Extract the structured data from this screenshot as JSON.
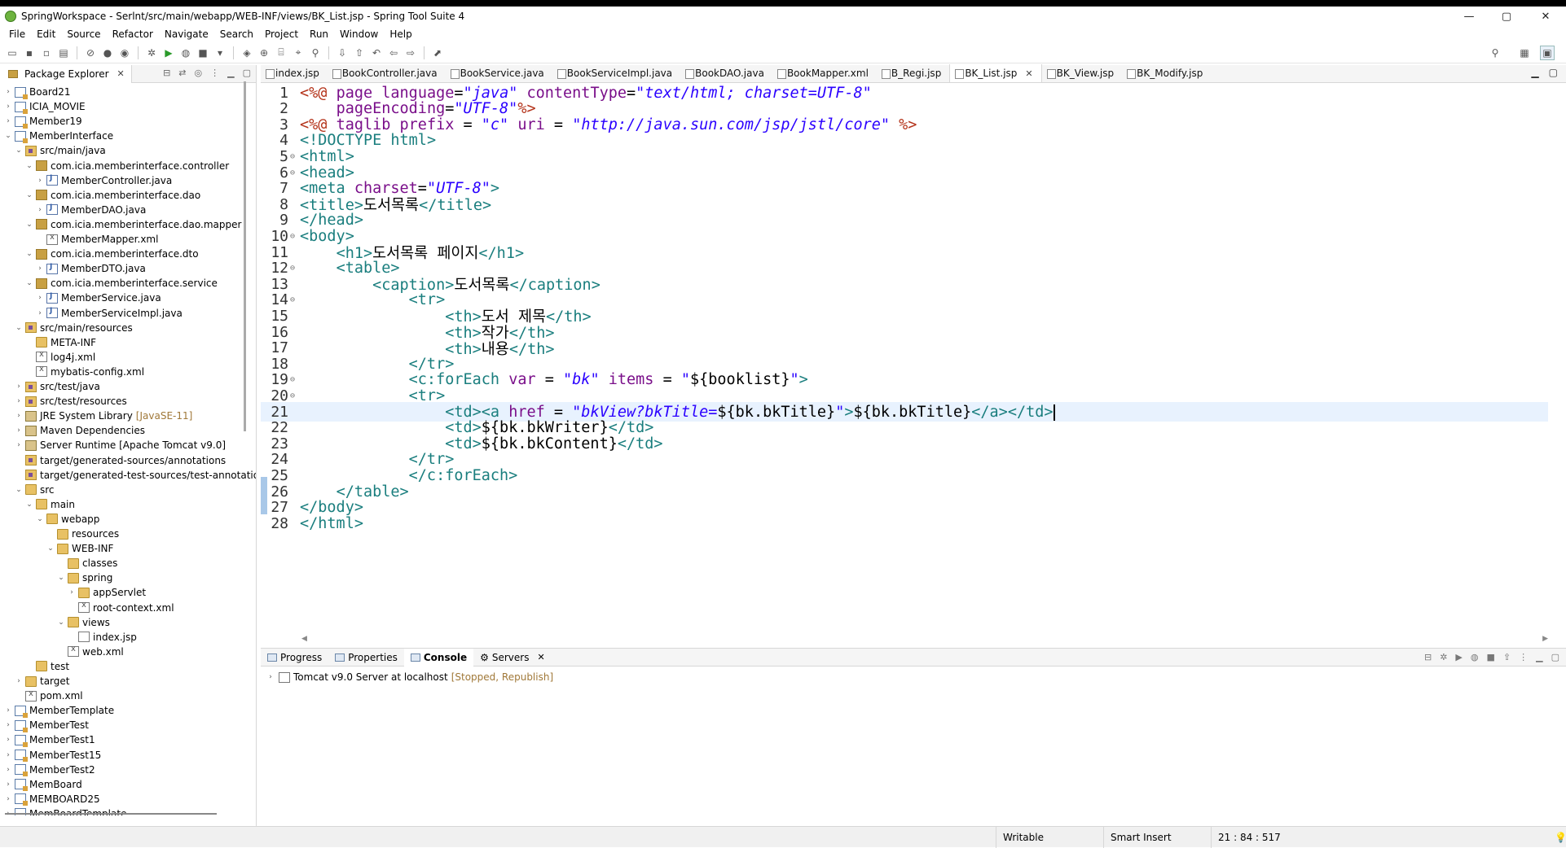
{
  "window": {
    "title": "SpringWorkspace - Serlnt/src/main/webapp/WEB-INF/views/BK_List.jsp - Spring Tool Suite 4",
    "minimize": "—",
    "maximize": "▢",
    "close": "✕"
  },
  "menu": [
    "File",
    "Edit",
    "Source",
    "Refactor",
    "Navigate",
    "Search",
    "Project",
    "Run",
    "Window",
    "Help"
  ],
  "left_panel": {
    "tab_label": "Package Explorer",
    "tree": [
      {
        "depth": 0,
        "twisty": "›",
        "icon": "project",
        "label": "Board21"
      },
      {
        "depth": 0,
        "twisty": "›",
        "icon": "project",
        "label": "ICIA_MOVIE"
      },
      {
        "depth": 0,
        "twisty": "›",
        "icon": "project",
        "label": "Member19"
      },
      {
        "depth": 0,
        "twisty": "⌄",
        "icon": "project",
        "label": "MemberInterface"
      },
      {
        "depth": 1,
        "twisty": "⌄",
        "icon": "src",
        "label": "src/main/java"
      },
      {
        "depth": 2,
        "twisty": "⌄",
        "icon": "pkg",
        "label": "com.icia.memberinterface.controller"
      },
      {
        "depth": 3,
        "twisty": "›",
        "icon": "java",
        "label": "MemberController.java"
      },
      {
        "depth": 2,
        "twisty": "⌄",
        "icon": "pkg",
        "label": "com.icia.memberinterface.dao"
      },
      {
        "depth": 3,
        "twisty": "›",
        "icon": "java",
        "label": "MemberDAO.java"
      },
      {
        "depth": 2,
        "twisty": "⌄",
        "icon": "pkg",
        "label": "com.icia.memberinterface.dao.mapper"
      },
      {
        "depth": 3,
        "twisty": "",
        "icon": "xml",
        "label": "MemberMapper.xml"
      },
      {
        "depth": 2,
        "twisty": "⌄",
        "icon": "pkg",
        "label": "com.icia.memberinterface.dto"
      },
      {
        "depth": 3,
        "twisty": "›",
        "icon": "java",
        "label": "MemberDTO.java"
      },
      {
        "depth": 2,
        "twisty": "⌄",
        "icon": "pkg",
        "label": "com.icia.memberinterface.service"
      },
      {
        "depth": 3,
        "twisty": "›",
        "icon": "java",
        "label": "MemberService.java"
      },
      {
        "depth": 3,
        "twisty": "›",
        "icon": "java",
        "label": "MemberServiceImpl.java"
      },
      {
        "depth": 1,
        "twisty": "⌄",
        "icon": "src",
        "label": "src/main/resources"
      },
      {
        "depth": 2,
        "twisty": "",
        "icon": "folder",
        "label": "META-INF"
      },
      {
        "depth": 2,
        "twisty": "",
        "icon": "xml",
        "label": "log4j.xml"
      },
      {
        "depth": 2,
        "twisty": "",
        "icon": "xml",
        "label": "mybatis-config.xml"
      },
      {
        "depth": 1,
        "twisty": "›",
        "icon": "src",
        "label": "src/test/java"
      },
      {
        "depth": 1,
        "twisty": "›",
        "icon": "src",
        "label": "src/test/resources"
      },
      {
        "depth": 1,
        "twisty": "›",
        "icon": "lib",
        "label": "JRE System Library",
        "extra": "[JavaSE-11]"
      },
      {
        "depth": 1,
        "twisty": "›",
        "icon": "lib",
        "label": "Maven Dependencies"
      },
      {
        "depth": 1,
        "twisty": "›",
        "icon": "lib",
        "label": "Server Runtime [Apache Tomcat v9.0]"
      },
      {
        "depth": 1,
        "twisty": "",
        "icon": "src",
        "label": "target/generated-sources/annotations"
      },
      {
        "depth": 1,
        "twisty": "",
        "icon": "src",
        "label": "target/generated-test-sources/test-annotatio"
      },
      {
        "depth": 1,
        "twisty": "⌄",
        "icon": "folder",
        "label": "src"
      },
      {
        "depth": 2,
        "twisty": "⌄",
        "icon": "folder",
        "label": "main"
      },
      {
        "depth": 3,
        "twisty": "⌄",
        "icon": "folder",
        "label": "webapp"
      },
      {
        "depth": 4,
        "twisty": "",
        "icon": "folder",
        "label": "resources"
      },
      {
        "depth": 4,
        "twisty": "⌄",
        "icon": "folder",
        "label": "WEB-INF"
      },
      {
        "depth": 5,
        "twisty": "",
        "icon": "folder",
        "label": "classes"
      },
      {
        "depth": 5,
        "twisty": "⌄",
        "icon": "folder",
        "label": "spring"
      },
      {
        "depth": 6,
        "twisty": "›",
        "icon": "folder",
        "label": "appServlet"
      },
      {
        "depth": 6,
        "twisty": "",
        "icon": "xml",
        "label": "root-context.xml"
      },
      {
        "depth": 5,
        "twisty": "⌄",
        "icon": "folder",
        "label": "views"
      },
      {
        "depth": 6,
        "twisty": "",
        "icon": "jsp",
        "label": "index.jsp"
      },
      {
        "depth": 5,
        "twisty": "",
        "icon": "xml",
        "label": "web.xml"
      },
      {
        "depth": 2,
        "twisty": "",
        "icon": "folder",
        "label": "test"
      },
      {
        "depth": 1,
        "twisty": "›",
        "icon": "folder",
        "label": "target"
      },
      {
        "depth": 1,
        "twisty": "",
        "icon": "xml",
        "label": "pom.xml"
      },
      {
        "depth": 0,
        "twisty": "›",
        "icon": "project",
        "label": "MemberTemplate"
      },
      {
        "depth": 0,
        "twisty": "›",
        "icon": "project",
        "label": "MemberTest"
      },
      {
        "depth": 0,
        "twisty": "›",
        "icon": "project",
        "label": "MemberTest1"
      },
      {
        "depth": 0,
        "twisty": "›",
        "icon": "project",
        "label": "MemberTest15"
      },
      {
        "depth": 0,
        "twisty": "›",
        "icon": "project",
        "label": "MemberTest2"
      },
      {
        "depth": 0,
        "twisty": "›",
        "icon": "project",
        "label": "MemBoard"
      },
      {
        "depth": 0,
        "twisty": "›",
        "icon": "project",
        "label": "MEMBOARD25"
      },
      {
        "depth": 0,
        "twisty": "›",
        "icon": "project",
        "label": "MemBoardTemplate"
      }
    ]
  },
  "editor": {
    "tabs": [
      "index.jsp",
      "BookController.java",
      "BookService.java",
      "BookServiceImpl.java",
      "BookDAO.java",
      "BookMapper.xml",
      "B_Regi.jsp",
      "BK_List.jsp",
      "BK_View.jsp",
      "BK_Modify.jsp"
    ],
    "active_tab": "BK_List.jsp",
    "current_line": 21,
    "lines": [
      {
        "n": "1",
        "fold": "",
        "segs": [
          [
            "dir",
            "<%@ "
          ],
          [
            "attr",
            "page "
          ],
          [
            "attr",
            "language"
          ],
          [
            "el",
            "="
          ],
          [
            "str",
            "\"java\""
          ],
          [
            "el",
            " "
          ],
          [
            "attr",
            "contentType"
          ],
          [
            "el",
            "="
          ],
          [
            "str",
            "\"text/html; charset=UTF-8\""
          ]
        ]
      },
      {
        "n": "2",
        "fold": "",
        "segs": [
          [
            "el",
            "    "
          ],
          [
            "attr",
            "pageEncoding"
          ],
          [
            "el",
            "="
          ],
          [
            "str",
            "\"UTF-8\""
          ],
          [
            "dir",
            "%>"
          ]
        ]
      },
      {
        "n": "3",
        "fold": "",
        "segs": [
          [
            "dir",
            "<%@ "
          ],
          [
            "attr",
            "taglib "
          ],
          [
            "attr",
            "prefix"
          ],
          [
            "el",
            " = "
          ],
          [
            "str",
            "\"c\""
          ],
          [
            "el",
            " "
          ],
          [
            "attr",
            "uri"
          ],
          [
            "el",
            " = "
          ],
          [
            "str",
            "\"http://java.sun.com/jsp/jstl/core\""
          ],
          [
            "el",
            " "
          ],
          [
            "dir",
            "%>"
          ]
        ]
      },
      {
        "n": "4",
        "fold": "",
        "segs": [
          [
            "tag",
            "<!DOCTYPE "
          ],
          [
            "tag",
            "html"
          ],
          [
            "tag",
            ">"
          ]
        ]
      },
      {
        "n": "5",
        "fold": "⊖",
        "segs": [
          [
            "tag",
            "<html>"
          ]
        ]
      },
      {
        "n": "6",
        "fold": "⊖",
        "segs": [
          [
            "tag",
            "<head>"
          ]
        ]
      },
      {
        "n": "7",
        "fold": "",
        "segs": [
          [
            "tag",
            "<meta "
          ],
          [
            "attr",
            "charset"
          ],
          [
            "el",
            "="
          ],
          [
            "str",
            "\"UTF-8\""
          ],
          [
            "tag",
            ">"
          ]
        ]
      },
      {
        "n": "8",
        "fold": "",
        "segs": [
          [
            "tag",
            "<title>"
          ],
          [
            "el",
            "도서목록"
          ],
          [
            "tag",
            "</title>"
          ]
        ]
      },
      {
        "n": "9",
        "fold": "",
        "segs": [
          [
            "tag",
            "</head>"
          ]
        ]
      },
      {
        "n": "10",
        "fold": "⊖",
        "segs": [
          [
            "tag",
            "<body>"
          ]
        ]
      },
      {
        "n": "11",
        "fold": "",
        "segs": [
          [
            "el",
            "    "
          ],
          [
            "tag",
            "<h1>"
          ],
          [
            "el",
            "도서목록 페이지"
          ],
          [
            "tag",
            "</h1>"
          ]
        ]
      },
      {
        "n": "12",
        "fold": "⊖",
        "segs": [
          [
            "el",
            "    "
          ],
          [
            "tag",
            "<table>"
          ]
        ]
      },
      {
        "n": "13",
        "fold": "",
        "segs": [
          [
            "el",
            "        "
          ],
          [
            "tag",
            "<caption>"
          ],
          [
            "el",
            "도서목록"
          ],
          [
            "tag",
            "</caption>"
          ]
        ]
      },
      {
        "n": "14",
        "fold": "⊖",
        "segs": [
          [
            "el",
            "            "
          ],
          [
            "tag",
            "<tr>"
          ]
        ]
      },
      {
        "n": "15",
        "fold": "",
        "segs": [
          [
            "el",
            "                "
          ],
          [
            "tag",
            "<th>"
          ],
          [
            "el",
            "도서 제목"
          ],
          [
            "tag",
            "</th>"
          ]
        ]
      },
      {
        "n": "16",
        "fold": "",
        "segs": [
          [
            "el",
            "                "
          ],
          [
            "tag",
            "<th>"
          ],
          [
            "el",
            "작가"
          ],
          [
            "tag",
            "</th>"
          ]
        ]
      },
      {
        "n": "17",
        "fold": "",
        "segs": [
          [
            "el",
            "                "
          ],
          [
            "tag",
            "<th>"
          ],
          [
            "el",
            "내용"
          ],
          [
            "tag",
            "</th>"
          ]
        ]
      },
      {
        "n": "18",
        "fold": "",
        "segs": [
          [
            "el",
            "            "
          ],
          [
            "tag",
            "</tr>"
          ]
        ]
      },
      {
        "n": "19",
        "fold": "⊖",
        "segs": [
          [
            "el",
            "            "
          ],
          [
            "tag",
            "<c:forEach "
          ],
          [
            "attr",
            "var"
          ],
          [
            "el",
            " = "
          ],
          [
            "str",
            "\"bk\""
          ],
          [
            "el",
            " "
          ],
          [
            "attr",
            "items"
          ],
          [
            "el",
            " = "
          ],
          [
            "str",
            "\""
          ],
          [
            "el",
            "${booklist}"
          ],
          [
            "str",
            "\""
          ],
          [
            "tag",
            ">"
          ]
        ]
      },
      {
        "n": "20",
        "fold": "⊖",
        "segs": [
          [
            "el",
            "            "
          ],
          [
            "tag",
            "<tr>"
          ]
        ]
      },
      {
        "n": "21",
        "fold": "",
        "segs": [
          [
            "el",
            "                "
          ],
          [
            "tag",
            "<td><a "
          ],
          [
            "attr",
            "href"
          ],
          [
            "el",
            " = "
          ],
          [
            "str",
            "\"bkView?bkTitle="
          ],
          [
            "el",
            "${bk.bkTitle}"
          ],
          [
            "str",
            "\""
          ],
          [
            "tag",
            ">"
          ],
          [
            "el",
            "${bk.bkTitle}"
          ],
          [
            "tag",
            "</a></td>"
          ]
        ]
      },
      {
        "n": "22",
        "fold": "",
        "segs": [
          [
            "el",
            "                "
          ],
          [
            "tag",
            "<td>"
          ],
          [
            "el",
            "${bk.bkWriter}"
          ],
          [
            "tag",
            "</td>"
          ]
        ]
      },
      {
        "n": "23",
        "fold": "",
        "segs": [
          [
            "el",
            "                "
          ],
          [
            "tag",
            "<td>"
          ],
          [
            "el",
            "${bk.bkContent}"
          ],
          [
            "tag",
            "</td>"
          ]
        ]
      },
      {
        "n": "24",
        "fold": "",
        "segs": [
          [
            "el",
            "            "
          ],
          [
            "tag",
            "</tr>"
          ]
        ]
      },
      {
        "n": "25",
        "fold": "",
        "segs": [
          [
            "el",
            "            "
          ],
          [
            "tag",
            "</c:forEach>"
          ]
        ]
      },
      {
        "n": "26",
        "fold": "",
        "segs": [
          [
            "el",
            "    "
          ],
          [
            "tag",
            "</table>"
          ]
        ]
      },
      {
        "n": "27",
        "fold": "",
        "segs": [
          [
            "tag",
            "</body>"
          ]
        ]
      },
      {
        "n": "28",
        "fold": "",
        "segs": [
          [
            "tag",
            "</html>"
          ]
        ]
      }
    ]
  },
  "bottom": {
    "tabs": [
      "Progress",
      "Properties",
      "Console",
      "Servers"
    ],
    "active_tab": "Console",
    "server_name": "Tomcat v9.0 Server at localhost",
    "server_status": "[Stopped, Republish]"
  },
  "status": {
    "writable": "Writable",
    "insert_mode": "Smart Insert",
    "position": "21 : 84 : 517"
  },
  "colors": {
    "tag": "#1a7e7e",
    "attr": "#7a0f8a",
    "string": "#2a00ff",
    "directive": "#b4331a"
  }
}
